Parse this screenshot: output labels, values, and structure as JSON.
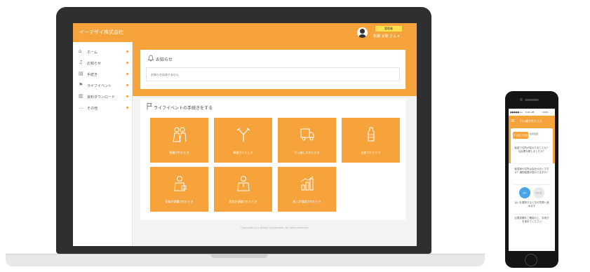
{
  "app": {
    "title": "イーデザイ株式会社",
    "badge": "管理者",
    "user_name": "佐藤 太郎 さん ▾"
  },
  "sidebar": {
    "items": [
      {
        "label": "ホーム",
        "icon": "home-icon"
      },
      {
        "label": "お知らせ",
        "icon": "bell-icon"
      },
      {
        "label": "手続き",
        "icon": "document-icon"
      },
      {
        "label": "ライフイベント",
        "icon": "flag-icon"
      },
      {
        "label": "資料ダウンロード",
        "icon": "download-icon"
      },
      {
        "label": "その他",
        "icon": "more-icon"
      }
    ]
  },
  "notice": {
    "title": "お知らせ",
    "text": "お知らせはありません"
  },
  "life_events": {
    "title": "ライフイベントの手続きをする",
    "tiles": [
      {
        "label": "結婚されたとき",
        "icon": "wedding-icon"
      },
      {
        "label": "離婚されたとき",
        "icon": "split-arrows-icon"
      },
      {
        "label": "引っ越しされたとき",
        "icon": "truck-icon"
      },
      {
        "label": "出産されたとき",
        "icon": "baby-bottle-icon"
      },
      {
        "label": "家族が就職されたとき",
        "icon": "family-icon"
      },
      {
        "label": "家族が退職されたとき",
        "icon": "person-icon"
      },
      {
        "label": "収入が増減されたとき",
        "icon": "bar-chart-icon"
      }
    ]
  },
  "footer": {
    "text": "Copyright (c) e-Design Corporation, All rights reserved."
  },
  "phone": {
    "status_carrier": "●●●●● au",
    "status_time": "9:41 AM",
    "status_battery": "100%",
    "header_title": "引っ越されたとき",
    "tab_active": "引っ越しの手続き",
    "tab_inactive": "住所変更",
    "question": "転居で住所が変わりましたか？住民票を移しましたか？",
    "question2": "転居後の住所は会社の近くですか？通勤経路が変わりますか？",
    "yes": "はい",
    "no": "いいえ",
    "note": "はいを選択すると次の質問へ進みます",
    "bottom_text": "必要書類をご確認の上、手続きを進めてください"
  },
  "colors": {
    "accent": "#f5a33a",
    "laptop": "#2f2f2f",
    "blue": "#4aa3e8"
  }
}
